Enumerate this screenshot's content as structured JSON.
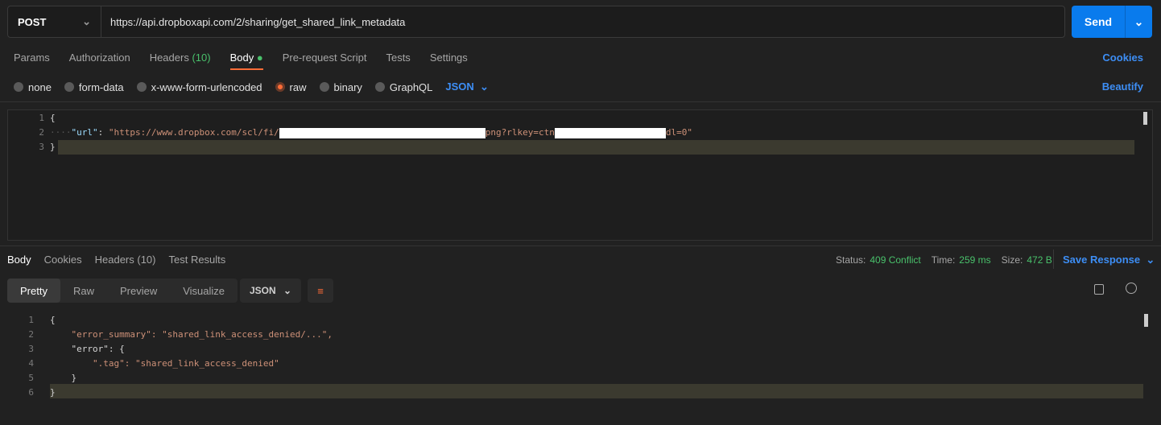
{
  "request": {
    "method": "POST",
    "url": "https://api.dropboxapi.com/2/sharing/get_shared_link_metadata",
    "send": "Send"
  },
  "req_tabs": [
    "Params",
    "Authorization",
    "Headers",
    "Body",
    "Pre-request Script",
    "Tests",
    "Settings"
  ],
  "headers_count": "(10)",
  "cookies": "Cookies",
  "body_types": [
    "none",
    "form-data",
    "x-www-form-urlencoded",
    "raw",
    "binary",
    "GraphQL"
  ],
  "body_format": "JSON",
  "beautify": "Beautify",
  "req_body": {
    "l1": "{",
    "key": "\"url\"",
    "colon": ": ",
    "v1": "\"https://www.dropbox.com/scl/fi/",
    "v2": "png?rlkey=ctn",
    "v3": "dl=0\"",
    "l3": "}"
  },
  "res_tabs": [
    "Body",
    "Cookies",
    "Headers (10)",
    "Test Results"
  ],
  "status": {
    "status_label": "Status:",
    "status": "409 Conflict",
    "time_label": "Time:",
    "time": "259 ms",
    "size_label": "Size:",
    "size": "472 B",
    "save": "Save Response"
  },
  "views": [
    "Pretty",
    "Raw",
    "Preview",
    "Visualize"
  ],
  "res_format": "JSON",
  "res_body": [
    "{",
    "    \"error_summary\": \"shared_link_access_denied/...\",",
    "    \"error\": {",
    "        \".tag\": \"shared_link_access_denied\"",
    "    }",
    "}"
  ],
  "colors": {
    "accent": "#ff6c37",
    "send": "#097bed",
    "status": "#49c16b"
  }
}
